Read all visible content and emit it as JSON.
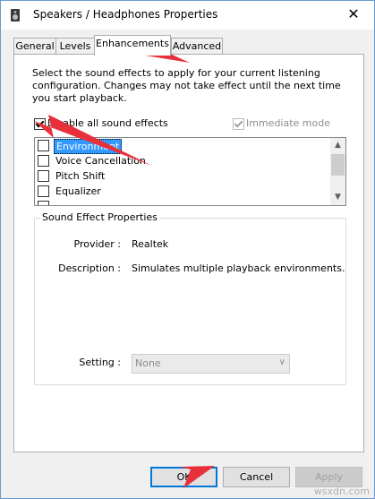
{
  "window": {
    "title": "Speakers / Headphones Properties",
    "close_glyph": "✕"
  },
  "tabs": [
    {
      "label": "General",
      "active": false
    },
    {
      "label": "Levels",
      "active": false
    },
    {
      "label": "Enhancements",
      "active": true
    },
    {
      "label": "Advanced",
      "active": false
    }
  ],
  "enhancements": {
    "description": "Select the sound effects to apply for your current listening configuration. Changes may not take effect until the next time you start playback.",
    "disable_all_label": "Disable all sound effects",
    "disable_all_checked": true,
    "immediate_mode_label": "Immediate mode",
    "immediate_mode_checked": true,
    "effects": [
      {
        "label": "Environment",
        "checked": false,
        "selected": true
      },
      {
        "label": "Voice Cancellation",
        "checked": false,
        "selected": false
      },
      {
        "label": "Pitch Shift",
        "checked": false,
        "selected": false
      },
      {
        "label": "Equalizer",
        "checked": false,
        "selected": false
      }
    ]
  },
  "properties": {
    "group_title": "Sound Effect Properties",
    "provider_label": "Provider :",
    "provider_value": "Realtek",
    "description_label": "Description :",
    "description_value": "Simulates multiple playback environments.",
    "setting_label": "Setting :",
    "setting_value": "None"
  },
  "buttons": {
    "ok": "OK",
    "cancel": "Cancel",
    "apply": "Apply"
  },
  "watermark": "wsxdn.com",
  "colors": {
    "annotation_arrow": "#e8303a",
    "selection": "#3399ff",
    "default_button_border": "#0078d7"
  }
}
